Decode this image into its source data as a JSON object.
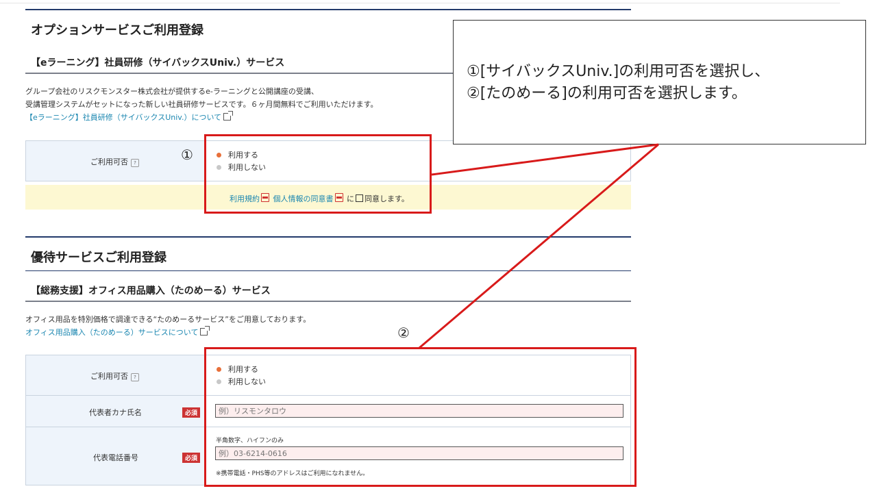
{
  "option_section": {
    "title": "オプションサービスご利用登録",
    "subsection_title": "【eラーニング】社員研修（サイバックスUniv.）サービス",
    "description_lines": [
      "グループ会社のリスクモンスター株式会社が提供するe-ラーニングと公開講座の受講、",
      "受講管理システムがセットになった新しい社員研修サービスです。６ヶ月間無料でご利用いただけます。"
    ],
    "about_link": "【eラーニング】社員研修（サイバックスUniv.）について",
    "usage_label": "ご利用可否",
    "help_icon": "?",
    "options": [
      "利用する",
      "利用しない"
    ],
    "selected_option": "利用する",
    "agreement": {
      "terms_link": "利用規約",
      "privacy_link": "個人情報の同意書",
      "particle": "に",
      "agree_text": "同意します。"
    }
  },
  "perk_section": {
    "title": "優待サービスご利用登録",
    "subsection_title": "【総務支援】オフィス用品購入（たのめーる）サービス",
    "description": "オフィス用品を特別価格で調達できる“たのめーるサービス”をご用意しております。",
    "about_link": "オフィス用品購入（たのめーる）サービスについて",
    "usage_label": "ご利用可否",
    "help_icon": "?",
    "options": [
      "利用する",
      "利用しない"
    ],
    "selected_option": "利用する",
    "kana_label": "代表者カナ氏名",
    "required_badge": "必須",
    "kana_placeholder": "例）リスモンタロウ",
    "phone_label": "代表電話番号",
    "phone_hint": "半角数字、ハイフンのみ",
    "phone_placeholder": "例）03-6214-0616",
    "phone_note": "※携帯電話・PHS等のアドレスはご利用になれません。"
  },
  "callout": {
    "line1": "①[サイバックスUniv.]の利用可否を選択し、",
    "line2": "②[たのめーる]の利用可否を選択します。"
  },
  "markers": {
    "one": "①",
    "two": "②"
  },
  "colors": {
    "highlight": "#d81a1a",
    "section_rule": "#223a6a",
    "link": "#1a86b0",
    "radio_selected": "#e8703a",
    "agree_band": "#fdf8d2",
    "required": "#cc3333"
  },
  "icons": {
    "external_link": "external-link-icon",
    "pdf": "pdf-icon",
    "help": "help-icon"
  }
}
